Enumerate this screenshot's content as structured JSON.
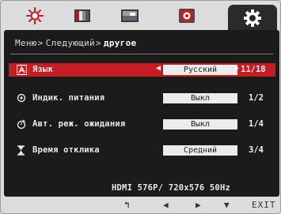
{
  "tabs": [
    {
      "name": "brightness",
      "icon": "sun-icon"
    },
    {
      "name": "color",
      "icon": "color-bars-icon"
    },
    {
      "name": "picture",
      "icon": "picture-icon"
    },
    {
      "name": "input",
      "icon": "input-source-icon"
    },
    {
      "name": "other",
      "icon": "gear-icon",
      "active": true
    }
  ],
  "breadcrumb": {
    "item1": "Меню",
    "sep1": ">",
    "item2": "Следующий",
    "sep2": ">",
    "current": "другое"
  },
  "rows": [
    {
      "icon": "language-icon",
      "label": "Язык",
      "value": "Русский",
      "page": "11/18",
      "selected": true
    },
    {
      "icon": "power-led-icon",
      "label": "Индик. питания",
      "value": "Выкл",
      "page": "1/2"
    },
    {
      "icon": "standby-timer-icon",
      "label": "Авт. реж. ожидания",
      "value": "Выкл",
      "page": "1/4"
    },
    {
      "icon": "hourglass-icon",
      "label": "Время отклика",
      "value": "Средний",
      "page": "3/4"
    }
  ],
  "selector": {
    "left_arrow": "◀",
    "right_arrow": "▶"
  },
  "status": "HDMI 576P/ 720x576 50Hz",
  "hints": {
    "back": "↰",
    "left": "◀",
    "right": "▶",
    "down": "▼",
    "exit": "EXIT"
  },
  "colors": {
    "panel": "#1b1b1b",
    "selection": "#c51d24",
    "frame": "#dcdcdc",
    "active_tab": "#2a2a2a"
  }
}
